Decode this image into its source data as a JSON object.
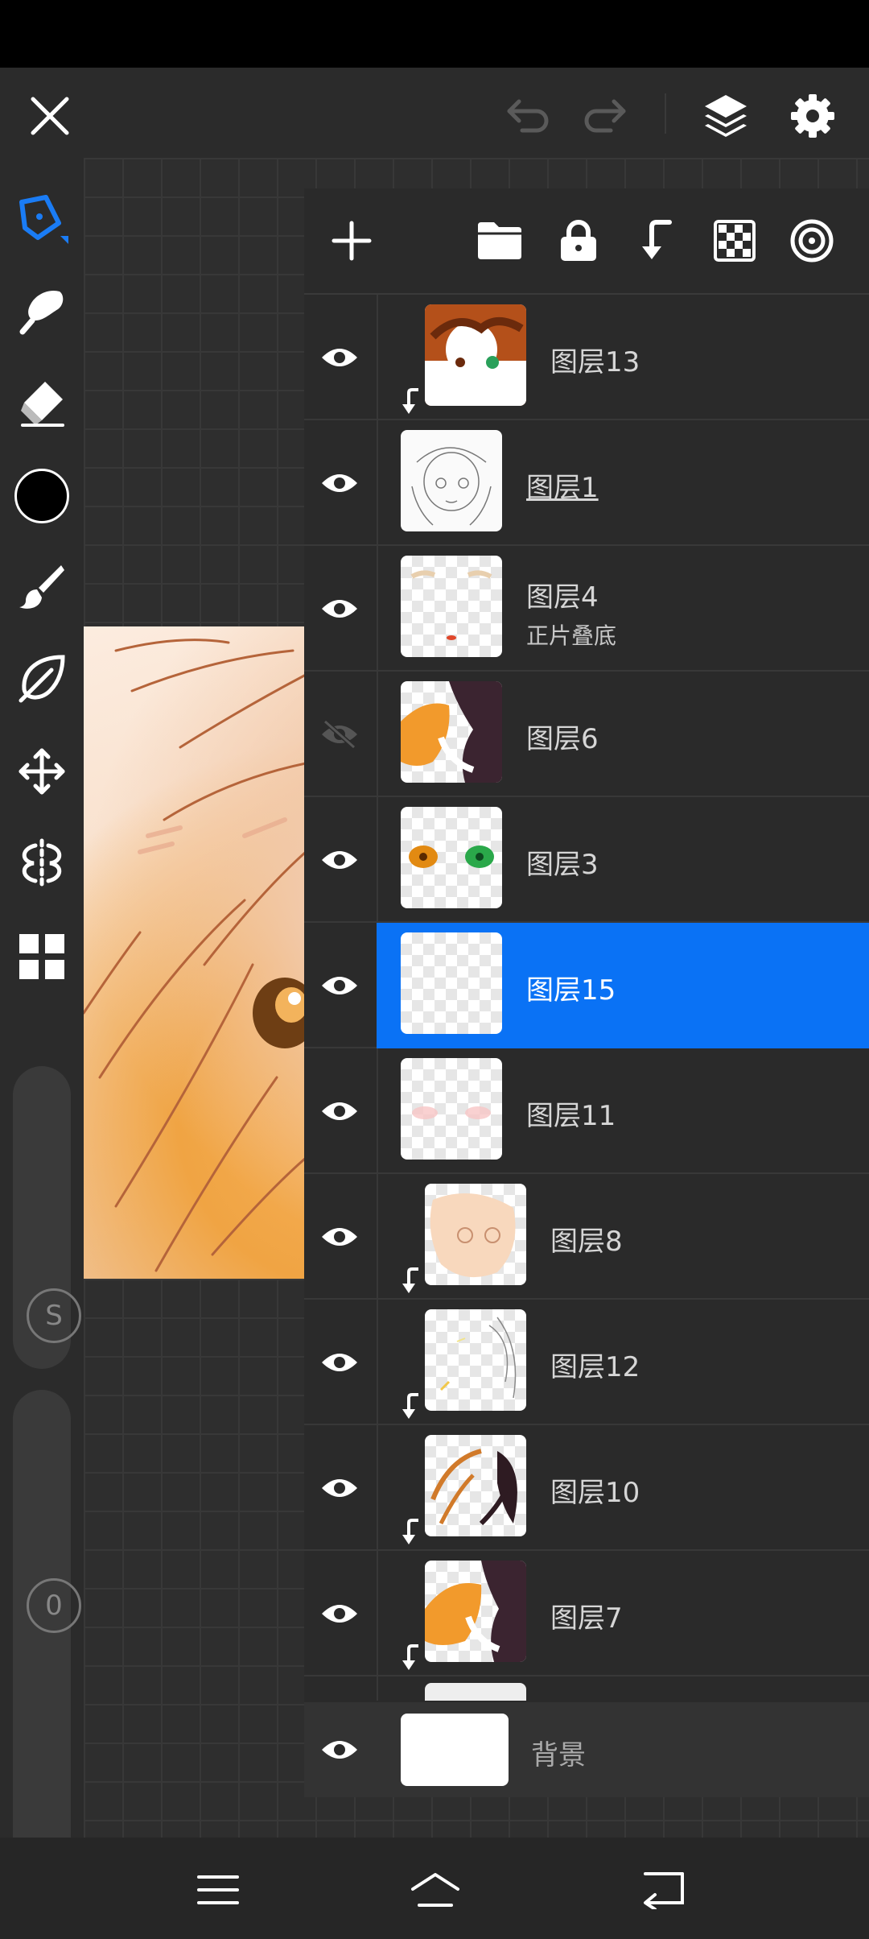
{
  "colors": {
    "accent": "#0a72f5",
    "panel_bg": "#2a2a2a",
    "canvas_bg": "#2e2e2e",
    "current_color": "#000000"
  },
  "top_bar": {
    "icons": [
      "close-icon",
      "undo-icon",
      "redo-icon",
      "layers-icon",
      "settings-icon"
    ]
  },
  "left_toolbar": {
    "tools": [
      "pen-icon",
      "smudge-icon",
      "eraser-icon",
      "color-swatch",
      "brush-icon",
      "leaf-icon",
      "move-icon",
      "symmetry-icon",
      "grid-icon"
    ],
    "size_badge": "S",
    "opacity_badge": "0"
  },
  "layers_panel": {
    "toolbar_icons": [
      "add-icon",
      "folder-icon",
      "lock-icon",
      "clip-icon",
      "transparency-icon",
      "target-icon"
    ],
    "layers": [
      {
        "name": "图层13",
        "visible": true,
        "clipped": true,
        "selected": false,
        "sub": ""
      },
      {
        "name": "图层1",
        "visible": true,
        "clipped": false,
        "selected": false,
        "sub": "",
        "underline": true
      },
      {
        "name": "图层4",
        "visible": true,
        "clipped": false,
        "selected": false,
        "sub": "正片叠底"
      },
      {
        "name": "图层6",
        "visible": false,
        "clipped": false,
        "selected": false,
        "sub": ""
      },
      {
        "name": "图层3",
        "visible": true,
        "clipped": false,
        "selected": false,
        "sub": ""
      },
      {
        "name": "图层15",
        "visible": true,
        "clipped": false,
        "selected": true,
        "sub": ""
      },
      {
        "name": "图层11",
        "visible": true,
        "clipped": false,
        "selected": false,
        "sub": ""
      },
      {
        "name": "图层8",
        "visible": true,
        "clipped": true,
        "selected": false,
        "sub": ""
      },
      {
        "name": "图层12",
        "visible": true,
        "clipped": true,
        "selected": false,
        "sub": ""
      },
      {
        "name": "图层10",
        "visible": true,
        "clipped": true,
        "selected": false,
        "sub": ""
      },
      {
        "name": "图层7",
        "visible": true,
        "clipped": true,
        "selected": false,
        "sub": ""
      }
    ],
    "background_layer": {
      "name": "背景",
      "visible": true
    }
  },
  "bottom_nav": {
    "icons": [
      "menu-icon",
      "home-icon",
      "back-icon"
    ]
  }
}
